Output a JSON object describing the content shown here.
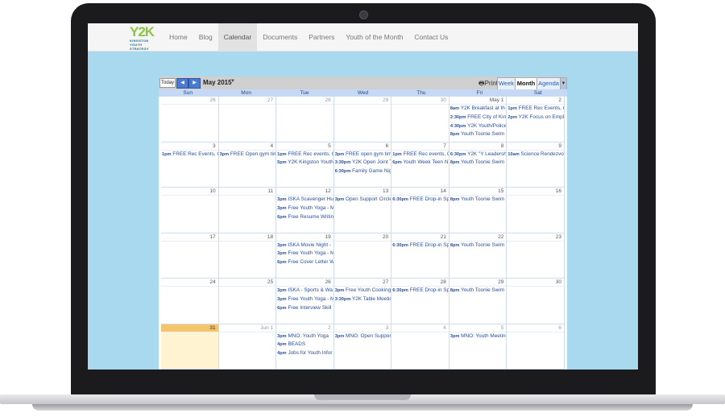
{
  "nav": {
    "logo": {
      "mark_a": "Y2",
      "mark_b": "K",
      "sub1": "KINGSTON",
      "sub2": "YOUTH STRATEGY"
    },
    "items": [
      "Home",
      "Blog",
      "Calendar",
      "Documents",
      "Partners",
      "Youth of the Month",
      "Contact Us"
    ],
    "active": "Calendar"
  },
  "calendar": {
    "today_label": "Today",
    "prev_icon": "◀",
    "next_icon": "▶",
    "month_label": "May 2015",
    "dropdown_caret": "▼",
    "print_label": "Print",
    "views": {
      "week": "Week",
      "month": "Month",
      "agenda": "Agenda",
      "more": "▼"
    },
    "days_of_week": [
      "Sun",
      "Mon",
      "Tue",
      "Wed",
      "Thu",
      "Fri",
      "Sat"
    ],
    "weeks": [
      {
        "days": [
          {
            "num": "26",
            "other": true,
            "events": []
          },
          {
            "num": "27",
            "other": true,
            "events": []
          },
          {
            "num": "28",
            "other": true,
            "events": []
          },
          {
            "num": "29",
            "other": true,
            "events": []
          },
          {
            "num": "30",
            "other": true,
            "events": []
          },
          {
            "num": "May 1",
            "events": [
              {
                "time": "8am",
                "title": "Y2K Breakfast at th"
              },
              {
                "time": "2:30pm",
                "title": "FREE City of King"
              },
              {
                "time": "4:30pm",
                "title": "Y2K Youth/Police"
              },
              {
                "time": "8pm",
                "title": "Youth Toonie Swim"
              }
            ]
          },
          {
            "num": "2",
            "events": [
              {
                "time": "1pm",
                "title": "FREE Rec Events, C"
              },
              {
                "time": "2pm",
                "title": "Y2K Focus on Emplo"
              }
            ]
          }
        ]
      },
      {
        "days": [
          {
            "num": "3",
            "events": [
              {
                "time": "1pm",
                "title": "FREE Rec Events, C"
              }
            ]
          },
          {
            "num": "4",
            "events": [
              {
                "time": "3pm",
                "title": "FREE Open gym tim"
              }
            ]
          },
          {
            "num": "5",
            "events": [
              {
                "time": "1pm",
                "title": "FREE Rec events, C"
              },
              {
                "time": "5pm",
                "title": "Y2K Kingston Youth"
              }
            ]
          },
          {
            "num": "6",
            "events": [
              {
                "time": "3pm",
                "title": "FREE open gym tim"
              },
              {
                "time": "3:30pm",
                "title": "Y2K Open Joint T"
              },
              {
                "time": "6:30pm",
                "title": "Family Game Nig"
              }
            ]
          },
          {
            "num": "7",
            "events": [
              {
                "time": "1pm",
                "title": "FREE Rec events, C"
              },
              {
                "time": "6pm",
                "title": "Youth Week Teen N"
              }
            ]
          },
          {
            "num": "8",
            "events": [
              {
                "time": "6:30pm",
                "title": "Y2K \"Y Leadershi"
              },
              {
                "time": "8pm",
                "title": "Youth Toonie Swim"
              }
            ]
          },
          {
            "num": "9",
            "events": [
              {
                "time": "10am",
                "title": "Science Rendezvou"
              }
            ]
          }
        ]
      },
      {
        "days": [
          {
            "num": "10",
            "events": []
          },
          {
            "num": "11",
            "events": []
          },
          {
            "num": "12",
            "events": [
              {
                "time": "3pm",
                "title": "ISKA Scavenger Hu"
              },
              {
                "time": "3pm",
                "title": "Free Youth Yoga - M"
              },
              {
                "time": "6pm",
                "title": "Free Resume Writin"
              }
            ]
          },
          {
            "num": "13",
            "events": [
              {
                "time": "3pm",
                "title": "Open Support Circle"
              }
            ]
          },
          {
            "num": "14",
            "events": [
              {
                "time": "6:30pm",
                "title": "FREE Drop-in Spo"
              }
            ]
          },
          {
            "num": "15",
            "events": [
              {
                "time": "8pm",
                "title": "Youth Toonie Swim"
              }
            ]
          },
          {
            "num": "16",
            "events": []
          }
        ]
      },
      {
        "days": [
          {
            "num": "17",
            "events": []
          },
          {
            "num": "18",
            "events": []
          },
          {
            "num": "19",
            "events": [
              {
                "time": "3pm",
                "title": "ISKA Movie Night -"
              },
              {
                "time": "3pm",
                "title": "Free Youth Yoga - M"
              },
              {
                "time": "6pm",
                "title": "Free Cover Letter W"
              }
            ]
          },
          {
            "num": "20",
            "events": []
          },
          {
            "num": "21",
            "events": [
              {
                "time": "6:30pm",
                "title": "FREE Drop-in Spo"
              }
            ]
          },
          {
            "num": "22",
            "events": [
              {
                "time": "8pm",
                "title": "Youth Toonie Swim"
              }
            ]
          },
          {
            "num": "23",
            "events": []
          }
        ]
      },
      {
        "days": [
          {
            "num": "24",
            "events": []
          },
          {
            "num": "25",
            "events": []
          },
          {
            "num": "26",
            "events": [
              {
                "time": "3pm",
                "title": "ISKA - Sports & Wa"
              },
              {
                "time": "3pm",
                "title": "Free Youth Yoga - M"
              },
              {
                "time": "6pm",
                "title": "Free Interview Skill"
              }
            ]
          },
          {
            "num": "27",
            "events": [
              {
                "time": "3pm",
                "title": "Free Youth Cooking"
              },
              {
                "time": "3:30pm",
                "title": "Y2K Table Meetin"
              }
            ]
          },
          {
            "num": "28",
            "events": [
              {
                "time": "6:30pm",
                "title": "FREE Drop-in Spo"
              }
            ]
          },
          {
            "num": "29",
            "events": [
              {
                "time": "8pm",
                "title": "Youth Toonie Swim"
              }
            ]
          },
          {
            "num": "30",
            "events": []
          }
        ]
      },
      {
        "days": [
          {
            "num": "31",
            "today": true,
            "events": []
          },
          {
            "num": "Jun 1",
            "other": true,
            "events": []
          },
          {
            "num": "2",
            "other": true,
            "events": [
              {
                "time": "3pm",
                "title": "MNO: Youth Yoga"
              },
              {
                "time": "4pm",
                "title": "BEADS"
              },
              {
                "time": "4pm",
                "title": "Jobs for Youth Infor"
              }
            ]
          },
          {
            "num": "3",
            "other": true,
            "events": [
              {
                "time": "3pm",
                "title": "MNO: Open Support"
              }
            ]
          },
          {
            "num": "4",
            "other": true,
            "events": []
          },
          {
            "num": "5",
            "other": true,
            "events": [
              {
                "time": "3pm",
                "title": "MNO: Youth Meeting"
              }
            ]
          },
          {
            "num": "6",
            "other": true,
            "events": []
          }
        ]
      }
    ]
  }
}
